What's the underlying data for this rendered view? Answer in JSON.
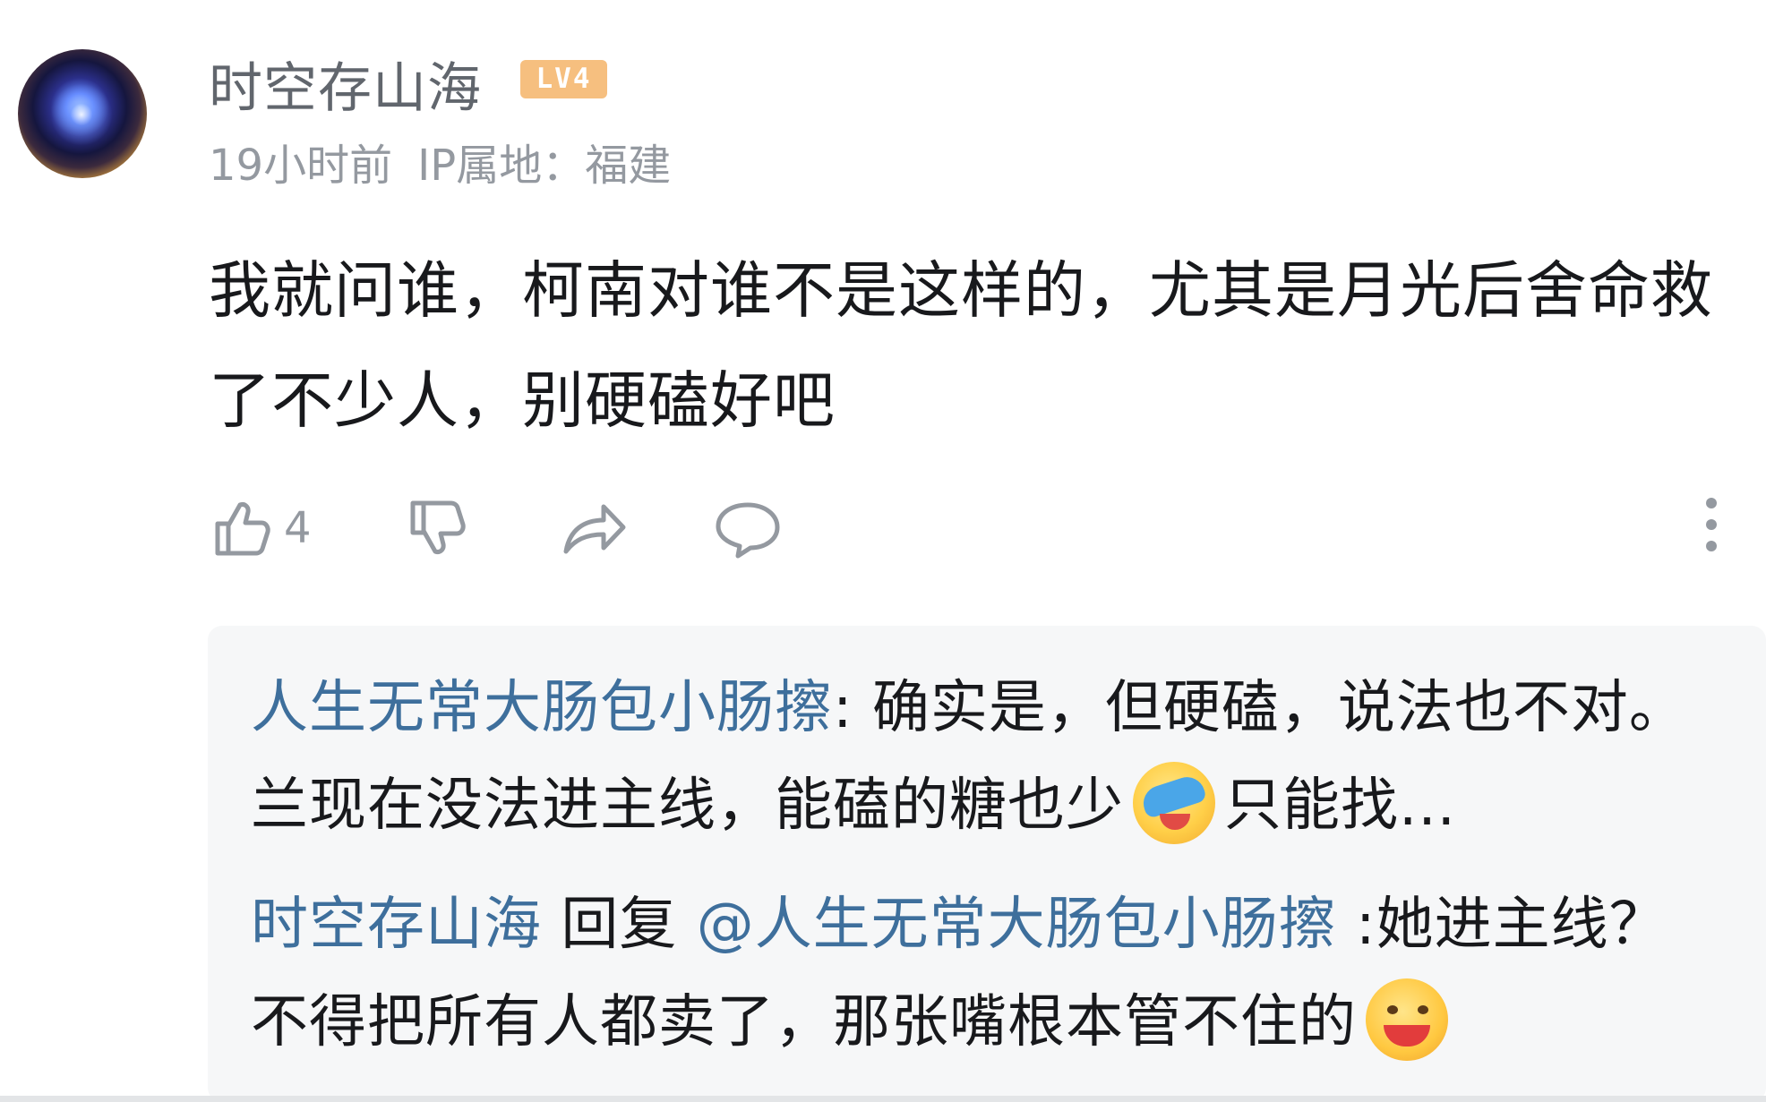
{
  "comment": {
    "avatar_icon": "user-avatar",
    "username": "时空存山海",
    "level_badge": "LV4",
    "time": "19小时前",
    "ip_location": "IP属地：福建",
    "text": "我就问谁，柯南对谁不是这样的，尤其是月光后舍命救了不少人，别硬磕好吧",
    "actions": {
      "like_count": "4",
      "like_icon": "thumbs-up-icon",
      "dislike_icon": "thumbs-down-icon",
      "share_icon": "share-icon",
      "reply_icon": "comment-bubble-icon",
      "more_icon": "more-vertical-icon"
    }
  },
  "replies": [
    {
      "author": "人生无常大肠包小肠擦",
      "text_before_emoji": ": 确实是，但硬磕，说法也不对。兰现在没法进主线，能磕的糖也少",
      "emoji": "cover-face-laugh-emoji",
      "text_after_emoji": "只能找..."
    },
    {
      "author": "时空存山海",
      "reply_word": " 回复 ",
      "mention": "@人生无常大肠包小肠擦",
      "text_before_emoji": " :她进主线？不得把所有人都卖了，那张嘴根本管不住的",
      "emoji": "grin-emoji"
    }
  ],
  "colors": {
    "username": "#61666d",
    "meta": "#9499a0",
    "reply_name": "#3e6f9c",
    "badge": "#f6bf7f",
    "reply_bg": "#f6f7f8"
  }
}
